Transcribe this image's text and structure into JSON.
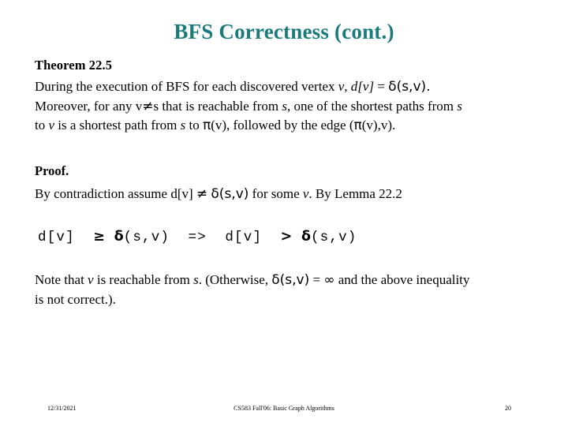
{
  "slide": {
    "title": "BFS Correctness (cont.)",
    "title_color": "#1a7b7d",
    "background_color": "#ffffff",
    "text_color": "#000000"
  },
  "theorem": {
    "heading": "Theorem 22.5",
    "line1_a": "During the execution of BFS for each discovered vertex ",
    "line1_v": "v",
    "line1_b": ", ",
    "line1_dv": "d[v]",
    "line1_c": " = ",
    "line1_delta": "δ(s,v).",
    "line2_a": "Moreover, for any v",
    "line2_neq": "≠",
    "line2_b": "s that is reachable from ",
    "line2_s": "s",
    "line2_c": ", one of the shortest paths from ",
    "line2_s2": "s",
    "line3_a": "to ",
    "line3_v": "v",
    "line3_b": " is a shortest path from ",
    "line3_s": "s",
    "line3_c": " to ",
    "line3_pi": "π",
    "line3_d": "(v), followed by the edge (",
    "line3_pi2": "π",
    "line3_e": "(v),v)."
  },
  "proof": {
    "heading": "Proof.",
    "line1_a": "By contradiction assume d[v] ",
    "line1_neq": "≠",
    "line1_b": " ",
    "line1_delta": "δ(s,v)",
    "line1_c": " for some ",
    "line1_v": "v",
    "line1_d": ". By Lemma 22.2",
    "formula_1": "d[v]  ",
    "formula_geq": "≥",
    "formula_2": " ",
    "formula_delta1": "δ",
    "formula_3": "(s,v)  =>  d[v]  ",
    "formula_gt": ">",
    "formula_4": " ",
    "formula_delta2": "δ",
    "formula_5": "(s,v)",
    "note_a": "Note that ",
    "note_v": "v",
    "note_b": " is reachable from ",
    "note_s": "s",
    "note_c": ". (Otherwise, ",
    "note_delta": "δ(s,v)",
    "note_d": " = ",
    "note_inf": "∞",
    "note_e": " and the above inequality",
    "note_line2": "is not correct.)."
  },
  "footer": {
    "date": "12/31/2021",
    "course": "CS583 Fall'06: Basic Graph Algorithms",
    "page_number": "20"
  }
}
